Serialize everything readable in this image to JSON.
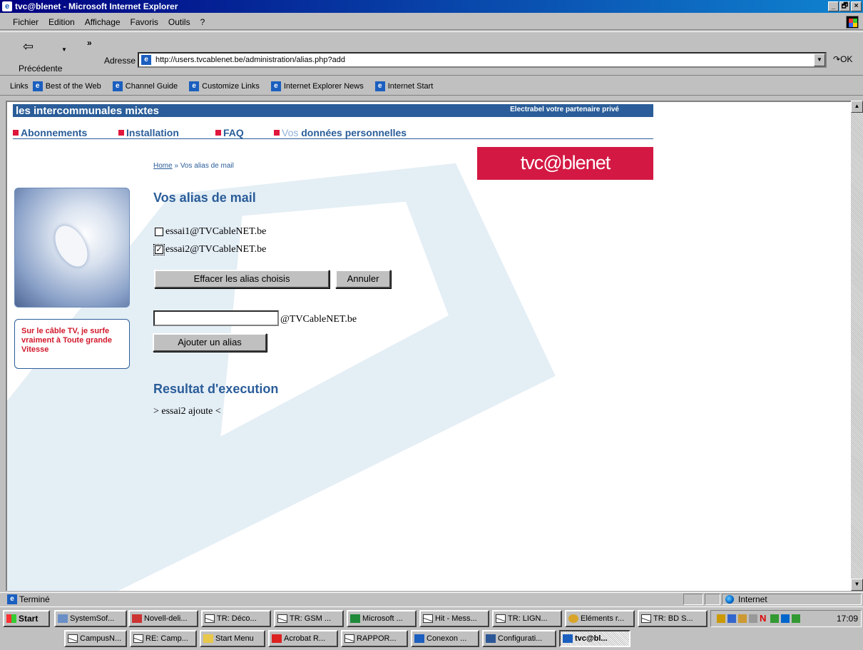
{
  "window": {
    "title": "tvc@blenet - Microsoft Internet Explorer",
    "icon": "ie-icon",
    "controls": [
      "_",
      "🗗",
      "×"
    ]
  },
  "menu": [
    "Fichier",
    "Edition",
    "Affichage",
    "Favoris",
    "Outils",
    "?"
  ],
  "toolbar": {
    "back_label": "Précédente",
    "address_label": "Adresse",
    "url": "http://users.tvcablenet.be/administration/alias.php?add",
    "go_label": "OK"
  },
  "links_bar": {
    "label": "Links",
    "items": [
      "Best of the Web",
      "Channel Guide",
      "Customize Links",
      "Internet Explorer News",
      "Internet Start"
    ]
  },
  "page": {
    "banner_title": "les intercommunales mixtes",
    "banner_tagline": "Electrabel votre partenaire privé",
    "nav": {
      "abonnements": "Abonnements",
      "installation": "Installation",
      "faq": "FAQ",
      "vos": "Vos",
      "donnees": "données personnelles"
    },
    "breadcrumb": {
      "home": "Home",
      "separator": "»",
      "current": "Vos alias de mail"
    },
    "logo": "tvc@blenet",
    "promo_text": "Sur le câble TV, je surfe vraiment à Toute grande Vitesse",
    "section_title": "Vos alias de mail",
    "aliases": [
      {
        "address": "essai1@TVCableNET.be",
        "checked": false
      },
      {
        "address": "essai2@TVCableNET.be",
        "checked": true
      }
    ],
    "delete_button": "Effacer les alias choisis",
    "cancel_button": "Annuler",
    "new_alias_value": "",
    "domain_suffix": "@TVCableNET.be",
    "add_button": "Ajouter un alias",
    "result_title": "Resultat d'execution",
    "result_text": "> essai2 ajoute <"
  },
  "status": {
    "text": "Terminé",
    "zone": "Internet"
  },
  "taskbar": {
    "start": "Start",
    "row1": [
      "SystemSof...",
      "Novell-deli...",
      "TR: Déco...",
      "TR: GSM ...",
      "Microsoft ...",
      "Hit - Mess...",
      "TR: LIGN...",
      "Eléments r...",
      "TR: BD S..."
    ],
    "row2": [
      "CampusN...",
      "RE: Camp...",
      "Start Menu",
      "Acrobat R...",
      "RAPPOR...",
      "Conexon ...",
      "Configurati...",
      "tvc@bl..."
    ],
    "active": "tvc@bl...",
    "clock": "17:09"
  },
  "colors": {
    "brand_blue": "#2a5d99",
    "brand_red": "#d31943",
    "promo_red": "#d2182b"
  }
}
